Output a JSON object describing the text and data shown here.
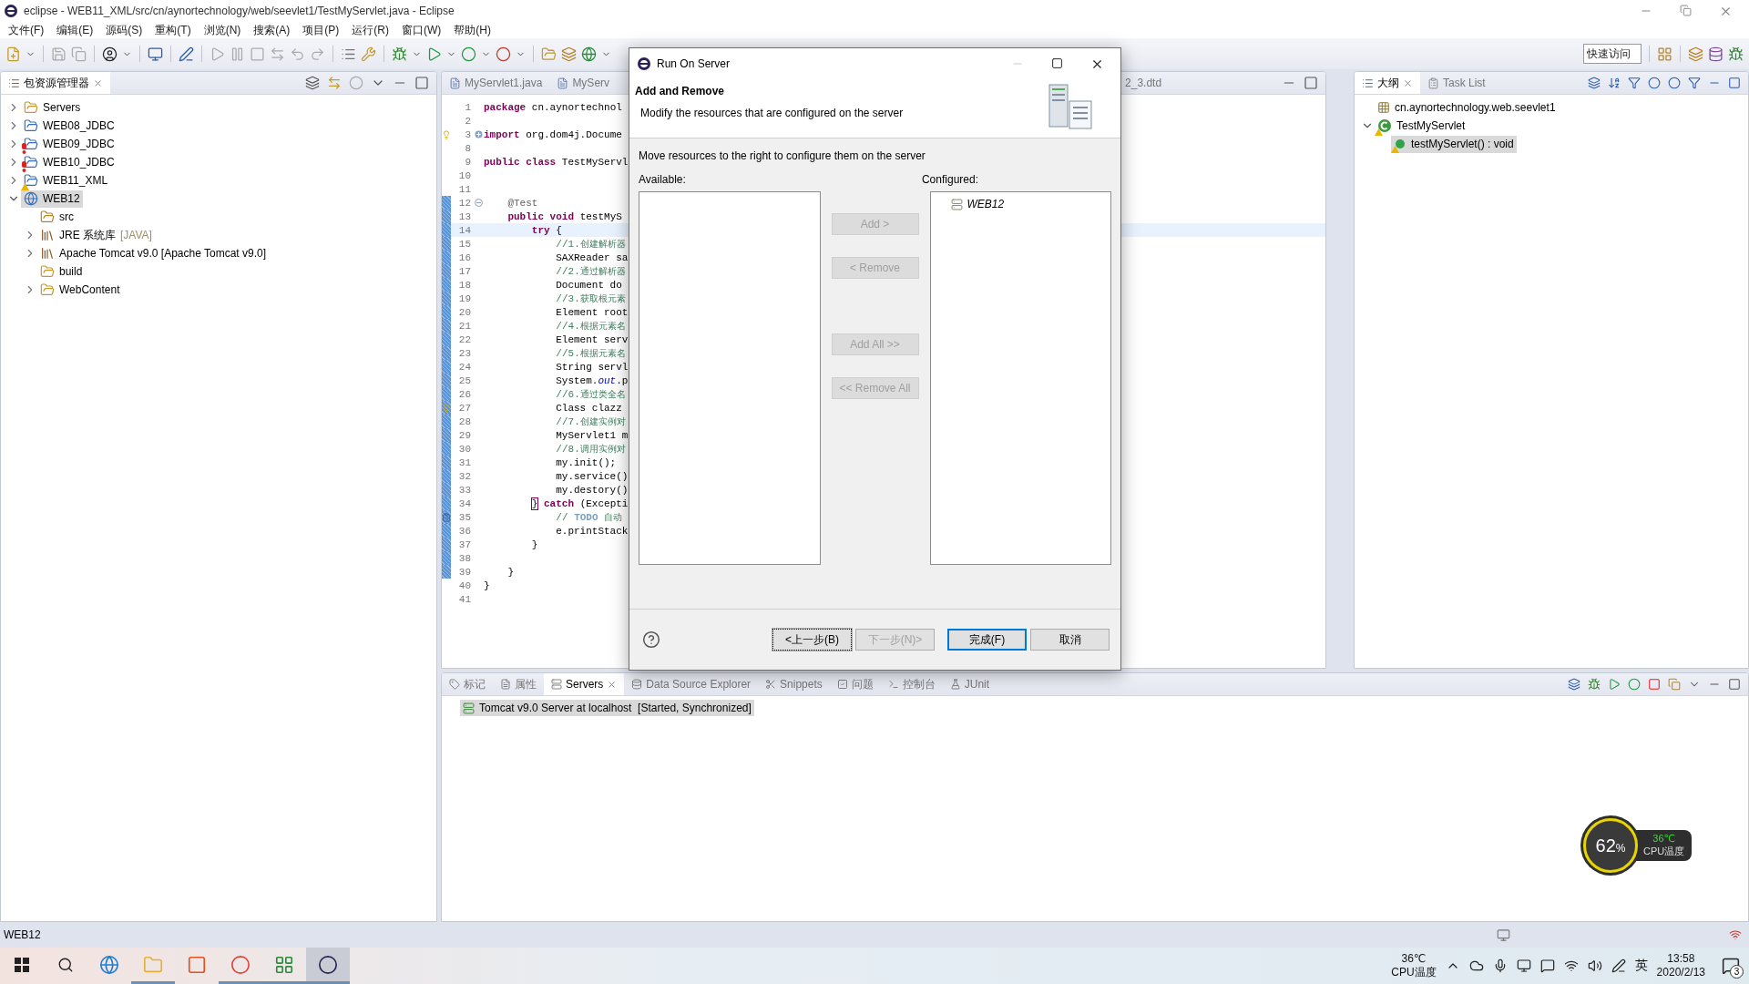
{
  "window": {
    "title": "eclipse - WEB11_XML/src/cn/aynortechnology/web/seevlet1/TestMyServlet.java - Eclipse"
  },
  "menu": [
    "文件(F)",
    "编辑(E)",
    "源码(S)",
    "重构(T)",
    "浏览(N)",
    "搜索(A)",
    "项目(P)",
    "运行(R)",
    "窗口(W)",
    "帮助(H)"
  ],
  "quick_access": {
    "placeholder": "快速访问"
  },
  "package_explorer": {
    "title": "包资源管理器",
    "items": [
      {
        "label": "Servers",
        "kind": "folder",
        "expanded": false,
        "error": false,
        "warning": false,
        "selected": false
      },
      {
        "label": "WEB08_JDBC",
        "kind": "project",
        "expanded": false,
        "error": false,
        "warning": false,
        "selected": false
      },
      {
        "label": "WEB09_JDBC",
        "kind": "project",
        "expanded": false,
        "error": true,
        "warning": false,
        "selected": false
      },
      {
        "label": "WEB10_JDBC",
        "kind": "project",
        "expanded": false,
        "error": true,
        "warning": false,
        "selected": false
      },
      {
        "label": "WEB11_XML",
        "kind": "project",
        "expanded": false,
        "error": false,
        "warning": true,
        "selected": false
      },
      {
        "label": "WEB12",
        "kind": "web-project",
        "expanded": true,
        "error": false,
        "warning": false,
        "selected": true,
        "children": [
          {
            "label": "src",
            "kind": "source",
            "error": false,
            "warning": false,
            "selected": false
          },
          {
            "label": "JRE 系统库",
            "note": "[JAVA]",
            "kind": "library",
            "expanded": false,
            "error": false,
            "warning": false,
            "selected": false
          },
          {
            "label": "Apache Tomcat v9.0 [Apache Tomcat v9.0]",
            "kind": "library",
            "expanded": false,
            "error": false,
            "warning": false,
            "selected": false
          },
          {
            "label": "build",
            "kind": "folder",
            "error": false,
            "warning": false,
            "selected": false
          },
          {
            "label": "WebContent",
            "kind": "folder",
            "expanded": false,
            "error": false,
            "warning": false,
            "selected": false
          }
        ]
      }
    ]
  },
  "editor": {
    "tabs": [
      "MyServlet1.java",
      "MyServ",
      "2_3.dtd"
    ],
    "lines": [
      {
        "number": "1",
        "current": false,
        "changed": false,
        "tokens": [
          {
            "kind": "keyword",
            "text": "package"
          },
          {
            "kind": "plain",
            "text": " cn.aynortechnol"
          }
        ]
      },
      {
        "number": "2",
        "current": false,
        "changed": false
      },
      {
        "number": "3",
        "current": false,
        "changed": false,
        "quick_fix": true,
        "folded": true,
        "tokens": [
          {
            "kind": "keyword",
            "text": "import"
          },
          {
            "kind": "plain",
            "text": " org.dom4j.Docume"
          }
        ]
      },
      {
        "number": "8",
        "current": false,
        "changed": false
      },
      {
        "number": "9",
        "current": false,
        "changed": false,
        "tokens": [
          {
            "kind": "keyword",
            "text": "public class"
          },
          {
            "kind": "plain",
            "text": " TestMyServl"
          }
        ]
      },
      {
        "number": "10",
        "current": false,
        "changed": false
      },
      {
        "number": "11",
        "current": false,
        "changed": false
      },
      {
        "number": "12",
        "current": false,
        "changed": true,
        "folded": false,
        "tokens": [
          {
            "kind": "annotation",
            "text": "    @Test"
          }
        ]
      },
      {
        "number": "13",
        "current": false,
        "changed": true,
        "tokens": [
          {
            "kind": "keyword",
            "text": "    public void"
          },
          {
            "kind": "plain",
            "text": " testMyS"
          }
        ]
      },
      {
        "number": "14",
        "current": true,
        "changed": true,
        "tokens": [
          {
            "kind": "keyword",
            "text": "        try"
          },
          {
            "kind": "plain",
            "text": " {"
          }
        ]
      },
      {
        "number": "15",
        "current": false,
        "changed": true,
        "tokens": [
          {
            "kind": "comment",
            "text": "            //1.创建解析器"
          }
        ]
      },
      {
        "number": "16",
        "current": false,
        "changed": true,
        "tokens": [
          {
            "kind": "plain",
            "text": "            SAXReader sa"
          }
        ]
      },
      {
        "number": "17",
        "current": false,
        "changed": true,
        "tokens": [
          {
            "kind": "comment",
            "text": "            //2.通过解析器"
          }
        ]
      },
      {
        "number": "18",
        "current": false,
        "changed": true,
        "tokens": [
          {
            "kind": "plain",
            "text": "            Document do"
          }
        ]
      },
      {
        "number": "19",
        "current": false,
        "changed": true,
        "tokens": [
          {
            "kind": "comment",
            "text": "            //3.获取根元素"
          }
        ]
      },
      {
        "number": "20",
        "current": false,
        "changed": true,
        "tokens": [
          {
            "kind": "plain",
            "text": "            Element root"
          }
        ]
      },
      {
        "number": "21",
        "current": false,
        "changed": true,
        "tokens": [
          {
            "kind": "comment",
            "text": "            //4.根据元素名"
          }
        ]
      },
      {
        "number": "22",
        "current": false,
        "changed": true,
        "tokens": [
          {
            "kind": "plain",
            "text": "            Element serv"
          }
        ]
      },
      {
        "number": "23",
        "current": false,
        "changed": true,
        "tokens": [
          {
            "kind": "comment",
            "text": "            //5.根据元素名"
          }
        ]
      },
      {
        "number": "24",
        "current": false,
        "changed": true,
        "tokens": [
          {
            "kind": "plain",
            "text": "            String servl"
          }
        ]
      },
      {
        "number": "25",
        "current": false,
        "changed": true,
        "tokens": [
          {
            "kind": "plain",
            "text": "            System."
          },
          {
            "kind": "field",
            "text": "out"
          },
          {
            "kind": "plain",
            "text": ".p"
          }
        ]
      },
      {
        "number": "26",
        "current": false,
        "changed": true,
        "tokens": [
          {
            "kind": "comment",
            "text": "            //6.通过类全名"
          }
        ]
      },
      {
        "number": "27",
        "current": false,
        "changed": true,
        "quick_fix": true,
        "tokens": [
          {
            "kind": "plain",
            "text": "            Class clazz"
          }
        ]
      },
      {
        "number": "28",
        "current": false,
        "changed": true,
        "tokens": [
          {
            "kind": "comment",
            "text": "            //7.创建实例对"
          }
        ]
      },
      {
        "number": "29",
        "current": false,
        "changed": true,
        "tokens": [
          {
            "kind": "plain",
            "text": "            MyServlet1 m"
          }
        ]
      },
      {
        "number": "30",
        "current": false,
        "changed": true,
        "tokens": [
          {
            "kind": "comment",
            "text": "            //8.调用实例对"
          }
        ]
      },
      {
        "number": "31",
        "current": false,
        "changed": true,
        "tokens": [
          {
            "kind": "plain",
            "text": "            my.init();"
          }
        ]
      },
      {
        "number": "32",
        "current": false,
        "changed": true,
        "tokens": [
          {
            "kind": "plain",
            "text": "            my.service()"
          }
        ]
      },
      {
        "number": "33",
        "current": false,
        "changed": true,
        "tokens": [
          {
            "kind": "plain",
            "text": "            my.destory()"
          }
        ]
      },
      {
        "number": "34",
        "current": false,
        "changed": true,
        "tokens": [
          {
            "kind": "bracket",
            "text": "        }"
          },
          {
            "kind": "keyword",
            "text": " catch"
          },
          {
            "kind": "plain",
            "text": " (Excepti"
          }
        ]
      },
      {
        "number": "35",
        "current": false,
        "changed": true,
        "task": true,
        "tokens": [
          {
            "kind": "comment",
            "text": "            // "
          },
          {
            "kind": "todo",
            "text": "TODO"
          },
          {
            "kind": "comment",
            "text": " 自动"
          }
        ]
      },
      {
        "number": "36",
        "current": false,
        "changed": true,
        "tokens": [
          {
            "kind": "plain",
            "text": "            e.printStack"
          }
        ]
      },
      {
        "number": "37",
        "current": false,
        "changed": true,
        "tokens": [
          {
            "kind": "plain",
            "text": "        }"
          }
        ]
      },
      {
        "number": "38",
        "current": false,
        "changed": true
      },
      {
        "number": "39",
        "current": false,
        "changed": true,
        "tokens": [
          {
            "kind": "plain",
            "text": "    }"
          }
        ]
      },
      {
        "number": "40",
        "current": false,
        "changed": false,
        "tokens": [
          {
            "kind": "plain",
            "text": "}"
          }
        ]
      },
      {
        "number": "41",
        "current": false,
        "changed": false
      }
    ]
  },
  "outline": {
    "tabs": [
      {
        "label": "大纲",
        "selected": true
      },
      {
        "label": "Task List",
        "selected": false
      }
    ],
    "items": [
      {
        "label": "cn.aynortechnology.web.seevlet1",
        "kind": "package",
        "error": false,
        "warning": false,
        "selected": false
      },
      {
        "label": "TestMyServlet",
        "kind": "class",
        "expanded": true,
        "error": false,
        "warning": true,
        "selected": false,
        "children": [
          {
            "label": "testMyServlet() : void",
            "kind": "method",
            "error": false,
            "warning": true,
            "selected": true
          }
        ]
      }
    ]
  },
  "servers_panel": {
    "tabs": [
      {
        "label": "标记",
        "selected": false
      },
      {
        "label": "属性",
        "selected": false
      },
      {
        "label": "Servers",
        "selected": true
      },
      {
        "label": "Data Source Explorer",
        "selected": false
      },
      {
        "label": "Snippets",
        "selected": false
      },
      {
        "label": "问题",
        "selected": false
      },
      {
        "label": "控制台",
        "selected": false
      },
      {
        "label": "JUnit",
        "selected": false
      }
    ],
    "rows": [
      {
        "label": "Tomcat v9.0 Server at localhost  [Started, Synchronized]",
        "selected": true
      }
    ]
  },
  "dialog": {
    "title": "Run On Server",
    "heading": "Add and Remove",
    "description": "Modify the resources that are configured on the server",
    "instruction": "Move resources to the right to configure them on the server",
    "available_label": "Available:",
    "configured_label": "Configured:",
    "configured": [
      "WEB12"
    ],
    "move_buttons": [
      {
        "label": "Add >",
        "disabled": true
      },
      {
        "label": "< Remove",
        "disabled": true
      },
      {
        "label": "Add All >>",
        "disabled": true
      },
      {
        "label": "<< Remove All",
        "disabled": true
      }
    ],
    "footer_buttons": [
      {
        "label": "<上一步(B)",
        "disabled": false,
        "default": false,
        "focused": true
      },
      {
        "label": "下一步(N)>",
        "disabled": true,
        "default": false,
        "focused": false
      },
      {
        "label": "完成(F)",
        "disabled": false,
        "default": true,
        "focused": false
      },
      {
        "label": "取消",
        "disabled": false,
        "default": false,
        "focused": false
      }
    ]
  },
  "cpu_widget": {
    "percent": "62",
    "unit": "%",
    "temperature": "36℃",
    "label": "CPU温度"
  },
  "status_bar": {
    "text": "WEB12"
  },
  "taskbar": {
    "apps": [
      {
        "kind": "edge",
        "running": false,
        "focused": false
      },
      {
        "kind": "explorer",
        "running": true,
        "focused": false
      },
      {
        "kind": "office",
        "running": false,
        "focused": false
      },
      {
        "kind": "chrome",
        "running": true,
        "focused": false
      },
      {
        "kind": "chart",
        "running": true,
        "focused": false
      },
      {
        "kind": "eclipse",
        "running": true,
        "focused": true
      }
    ],
    "temperature": "36℃",
    "temperature_label": "CPU温度",
    "ime": "英",
    "time": "13:58",
    "date": "2020/2/13",
    "notifications": "3"
  }
}
